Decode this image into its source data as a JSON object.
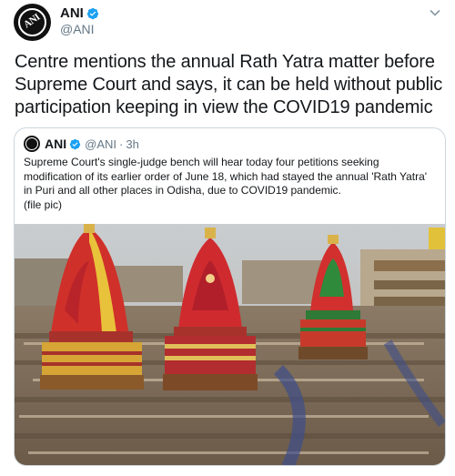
{
  "account": {
    "name": "ANI",
    "handle": "@ANI",
    "avatar_text": "ANI",
    "verified": true
  },
  "tweet": {
    "text": "Centre mentions the annual Rath Yatra matter before Supreme Court and says, it can be held without public participation keeping in view the COVID19 pandemic"
  },
  "quoted": {
    "name": "ANI",
    "handle": "@ANI",
    "separator": "·",
    "time": "3h",
    "text": "Supreme Court's single-judge bench will hear today four petitions seeking modification of its earlier order of June 18, which had stayed the annual 'Rath Yatra' in Puri and all other places in Odisha, due to COVID19 pandemic.",
    "note": "(file pic)",
    "image_icon": "photo-rath-yatra-chariots"
  },
  "colors": {
    "verified_blue": "#1da1f2",
    "text_primary": "#14171a",
    "text_secondary": "#657786",
    "border": "#ccd6dd"
  },
  "icons": {
    "menu": "chevron-down-icon",
    "verified": "verified-badge-icon"
  }
}
